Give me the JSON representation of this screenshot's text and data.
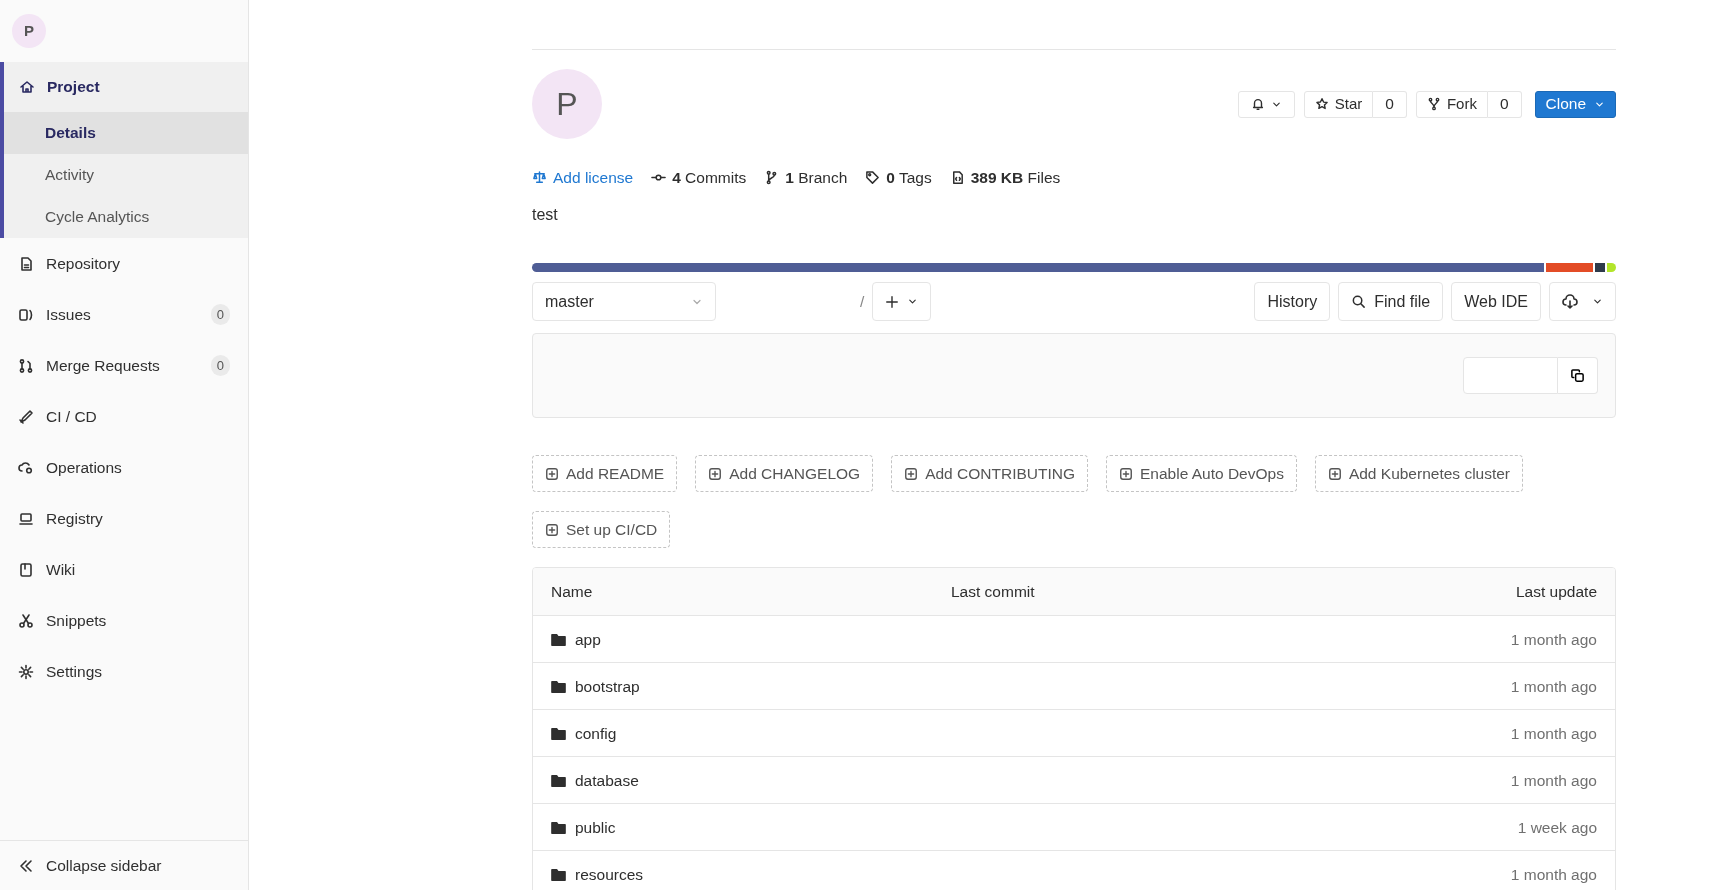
{
  "sidebar": {
    "avatar": "P",
    "nav": [
      {
        "label": "Project",
        "selected": true,
        "expanded": true,
        "children": [
          {
            "label": "Details",
            "selected": true
          },
          {
            "label": "Activity",
            "selected": false
          },
          {
            "label": "Cycle Analytics",
            "selected": false
          }
        ]
      },
      {
        "label": "Repository",
        "selected": false
      },
      {
        "label": "Issues",
        "selected": false,
        "badge": "0"
      },
      {
        "label": "Merge Requests",
        "selected": false,
        "badge": "0"
      },
      {
        "label": "CI / CD",
        "selected": false
      },
      {
        "label": "Operations",
        "selected": false
      },
      {
        "label": "Registry",
        "selected": false
      },
      {
        "label": "Wiki",
        "selected": false
      },
      {
        "label": "Snippets",
        "selected": false
      },
      {
        "label": "Settings",
        "selected": false
      }
    ],
    "collapse": "Collapse sidebar"
  },
  "project": {
    "avatar": "P",
    "star": {
      "label": "Star",
      "count": "0"
    },
    "fork": {
      "label": "Fork",
      "count": "0"
    },
    "clone": "Clone",
    "stats": [
      {
        "kind": "link",
        "text": "Add license"
      },
      {
        "kind": "stat",
        "text": "**4** Commits"
      },
      {
        "kind": "stat",
        "text": "**1** Branch"
      },
      {
        "kind": "stat",
        "text": "**0** Tags"
      },
      {
        "kind": "stat",
        "text": "**389 KB** Files"
      }
    ],
    "description": "test"
  },
  "language_bar": [
    {
      "color": "#4f5d95"
    },
    {
      "color": "#e34c26"
    },
    {
      "color": "#2f3b4b"
    },
    {
      "color": "#b3e52a"
    }
  ],
  "toolbar": {
    "branch": "master",
    "separator": "/",
    "buttons": [
      "History",
      "Find file",
      "Web IDE"
    ]
  },
  "suggestions": [
    "Add README",
    "Add CHANGELOG",
    "Add CONTRIBUTING",
    "Enable Auto DevOps",
    "Add Kubernetes cluster",
    "Set up CI/CD"
  ],
  "table": {
    "columns": [
      "Name",
      "Last commit",
      "Last update"
    ],
    "rows": [
      {
        "name": "app",
        "last_update": "1 month ago"
      },
      {
        "name": "bootstrap",
        "last_update": "1 month ago"
      },
      {
        "name": "config",
        "last_update": "1 month ago"
      },
      {
        "name": "database",
        "last_update": "1 month ago"
      },
      {
        "name": "public",
        "last_update": "1 week ago"
      },
      {
        "name": "resources",
        "last_update": "1 month ago"
      }
    ]
  }
}
